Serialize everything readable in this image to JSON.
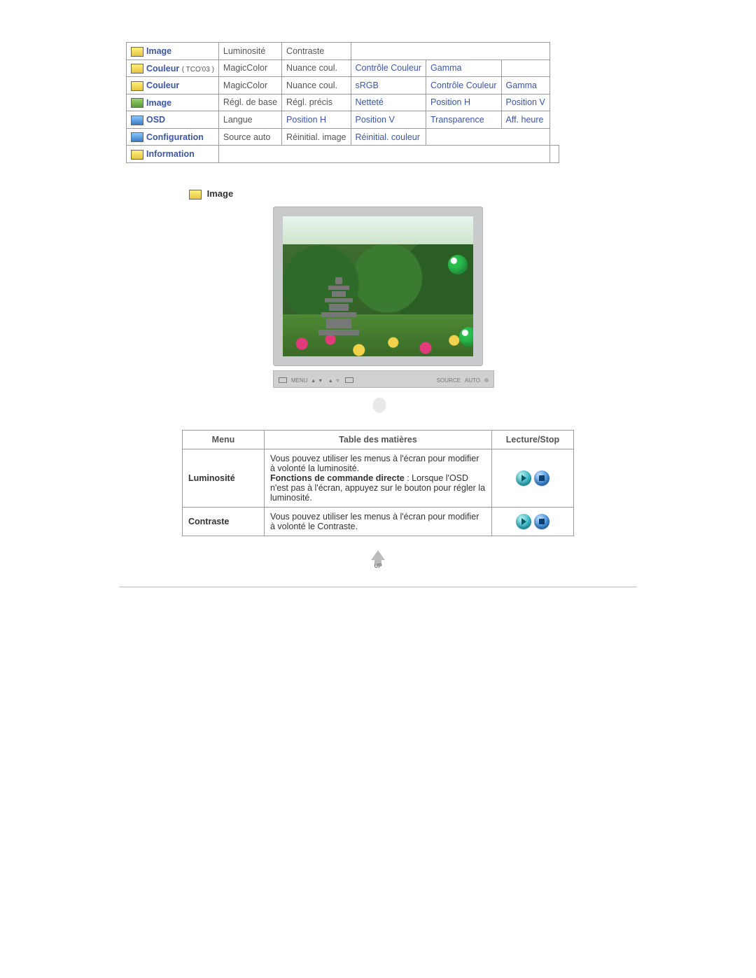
{
  "menu_table": {
    "rows": [
      {
        "icon": "yellow",
        "label": "Image",
        "sub": "",
        "cells": [
          "Luminosité",
          "Contraste",
          "",
          "",
          "",
          ""
        ],
        "links": [
          false,
          false
        ]
      },
      {
        "icon": "yellow",
        "label": "Couleur",
        "sub": "( TCO'03 )",
        "cells": [
          "MagicColor",
          "Nuance coul.",
          "Contrôle Couleur",
          "Gamma",
          "",
          ""
        ],
        "links": [
          false,
          false,
          true,
          true
        ]
      },
      {
        "icon": "yellow",
        "label": "Couleur",
        "sub": "",
        "cells": [
          "MagicColor",
          "Nuance coul.",
          "sRGB",
          "Contrôle Couleur",
          "Gamma",
          ""
        ],
        "links": [
          false,
          false,
          true,
          true,
          true
        ]
      },
      {
        "icon": "green",
        "label": "Image",
        "sub": "",
        "cells": [
          "Régl. de base",
          "Régl. précis",
          "Netteté",
          "Position H",
          "Position V",
          ""
        ],
        "links": [
          false,
          false,
          true,
          true,
          true
        ]
      },
      {
        "icon": "blue",
        "label": "OSD",
        "sub": "",
        "cells": [
          "Langue",
          "Position H",
          "Position V",
          "Transparence",
          "Aff. heure",
          ""
        ],
        "links": [
          false,
          true,
          true,
          true,
          true
        ]
      },
      {
        "icon": "blue",
        "label": "Configuration",
        "sub": "",
        "cells": [
          "Source auto",
          "Réinitial. image",
          "Réinitial. couleur",
          "",
          "",
          ""
        ],
        "links": [
          false,
          false,
          true
        ]
      },
      {
        "icon": "yellow",
        "label": "Information",
        "sub": "",
        "cells": [
          "",
          "",
          "",
          "",
          "",
          ""
        ],
        "links": []
      }
    ]
  },
  "section_heading": "Image",
  "monitor_buttons": {
    "menu": "MENU",
    "source": "SOURCE",
    "auto": "AUTO"
  },
  "desc_table": {
    "headers": [
      "Menu",
      "Table des matières",
      "Lecture/Stop"
    ],
    "rows": [
      {
        "name": "Luminosité",
        "text": "Vous pouvez utiliser les menus à l'écran pour modifier à volonté la luminosité.",
        "text2_label": "Fonctions de commande directe",
        "text2": " : Lorsque l'OSD n'est pas à l'écran, appuyez sur le bouton pour régler la luminosité."
      },
      {
        "name": "Contraste",
        "text": "Vous pouvez utiliser les menus à l'écran pour modifier à volonté le Contraste.",
        "text2_label": "",
        "text2": ""
      }
    ]
  },
  "up_label": "UP"
}
